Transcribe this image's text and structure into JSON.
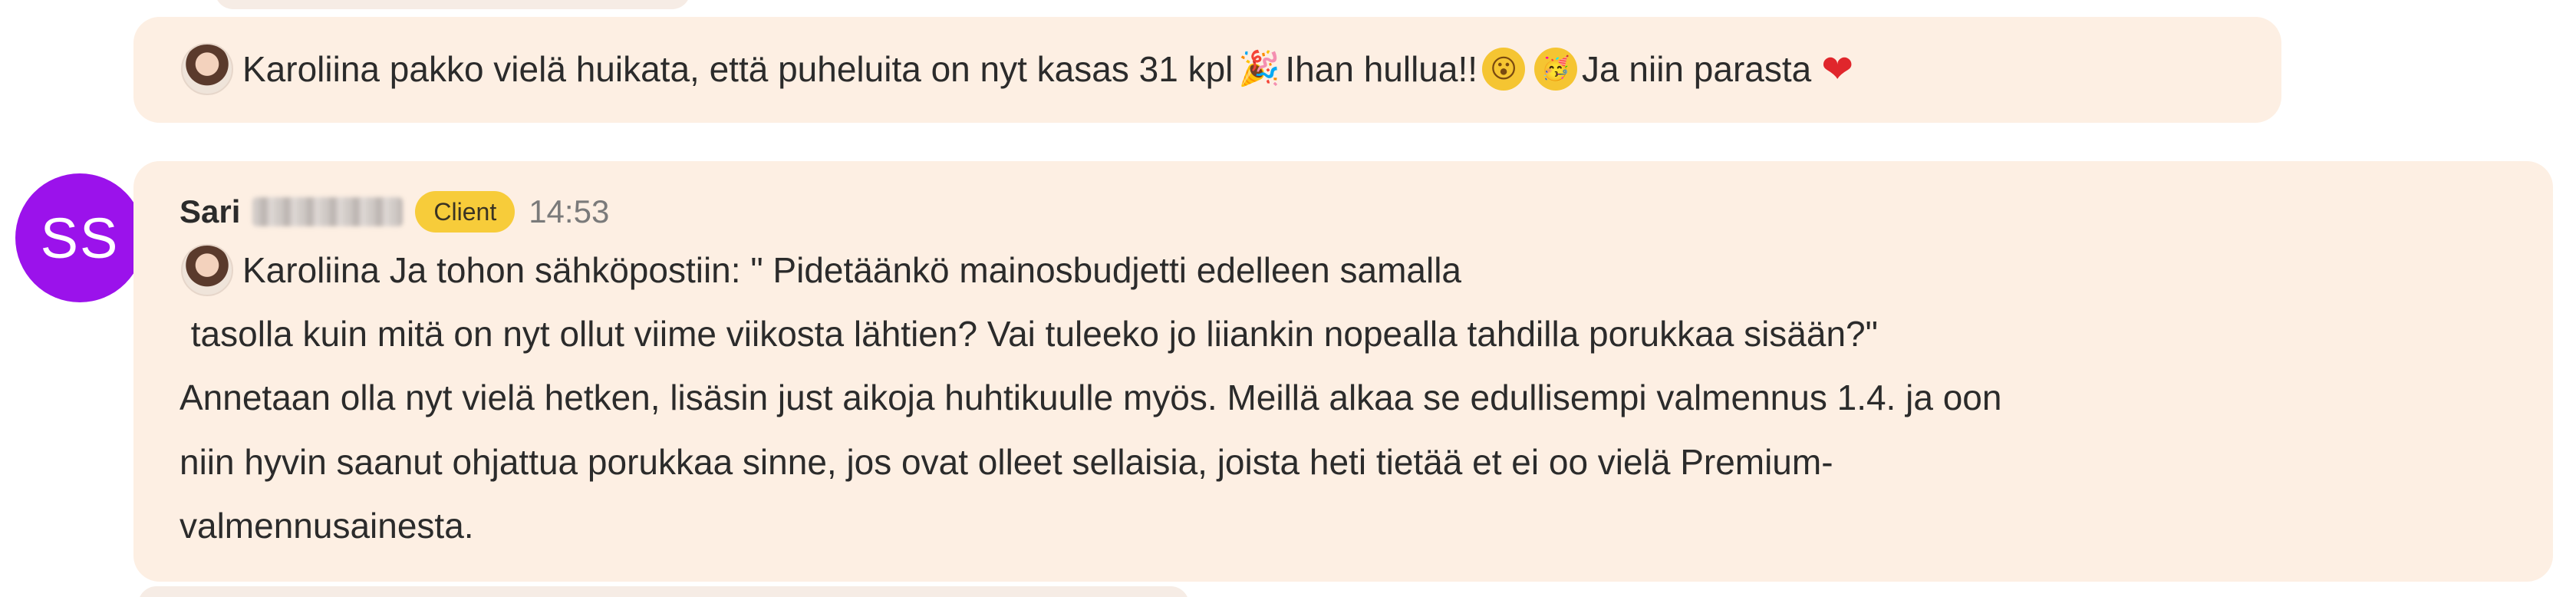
{
  "messages": [
    {
      "mention": "Karoliina",
      "text_a": "pakko vielä huikata, että puheluita on nyt kasas 31 kpl",
      "emoji_1": "🎉",
      "text_b": "Ihan hullua!!",
      "emoji_2": "😮",
      "emoji_3": "🥳",
      "text_c": "Ja niin parasta",
      "emoji_4": "❤"
    },
    {
      "avatar_initials": "SS",
      "sender_first_name": "Sari",
      "badge": "Client",
      "time": "14:53",
      "mention": "Karoliina",
      "line_1": "Ja tohon sähköpostiin: \" Pidetäänkö mainosbudjetti edelleen samalla",
      "line_2": " tasolla kuin mitä on nyt ollut viime viikosta lähtien? Vai tuleeko jo liiankin nopealla tahdilla porukkaa sisään?\"",
      "line_3": "Annetaan olla nyt vielä hetken, lisäsin just aikoja huhtikuulle myös. Meillä alkaa se edullisempi valmennus 1.4. ja oon",
      "line_4": "niin hyvin saanut ohjattua porukkaa sinne, jos ovat olleet sellaisia, joista heti tietää et ei oo vielä Premium-",
      "line_5": "valmennusainesta."
    }
  ]
}
